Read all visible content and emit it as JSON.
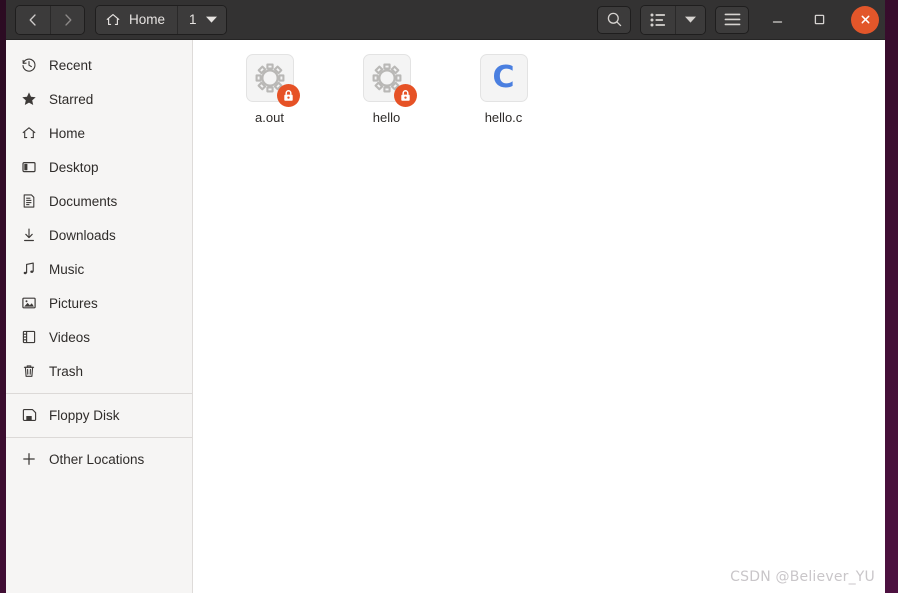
{
  "window": {
    "title": "Home",
    "colors": {
      "headerbar": "#333232",
      "sidebar": "#f6f5f4",
      "content": "#ffffff",
      "close_button": "#e2562a",
      "lock_badge": "#e65226",
      "c_glyph": "#4a7fe0",
      "desktop": "#3a0d2e"
    }
  },
  "headerbar": {
    "back_label": "Back",
    "forward_label": "Forward",
    "path_label": "Home",
    "tab_count": "1",
    "search_label": "Search",
    "view_list_label": "List view",
    "view_menu_label": "View options",
    "menu_label": "Main menu",
    "minimize_label": "Minimize",
    "maximize_label": "Maximize",
    "close_label": "Close"
  },
  "sidebar": {
    "groups": [
      {
        "items": [
          {
            "label": "Recent",
            "icon": "clock-icon"
          },
          {
            "label": "Starred",
            "icon": "star-icon"
          },
          {
            "label": "Home",
            "icon": "home-icon"
          },
          {
            "label": "Desktop",
            "icon": "desktop-icon"
          },
          {
            "label": "Documents",
            "icon": "document-icon"
          },
          {
            "label": "Downloads",
            "icon": "download-icon"
          },
          {
            "label": "Music",
            "icon": "music-note-icon"
          },
          {
            "label": "Pictures",
            "icon": "image-icon"
          },
          {
            "label": "Videos",
            "icon": "film-icon"
          },
          {
            "label": "Trash",
            "icon": "trash-icon"
          }
        ]
      },
      {
        "items": [
          {
            "label": "Floppy Disk",
            "icon": "floppy-disk-icon"
          }
        ]
      },
      {
        "items": [
          {
            "label": "Other Locations",
            "icon": "plus-icon"
          }
        ]
      }
    ]
  },
  "files": [
    {
      "name": "a.out",
      "icon": "executable-gear-icon",
      "badge": "lock-icon"
    },
    {
      "name": "hello",
      "icon": "executable-gear-icon",
      "badge": "lock-icon"
    },
    {
      "name": "hello.c",
      "icon": "c-source-icon",
      "glyph": "C"
    }
  ],
  "watermark": {
    "text": "CSDN @Believer_YU"
  }
}
